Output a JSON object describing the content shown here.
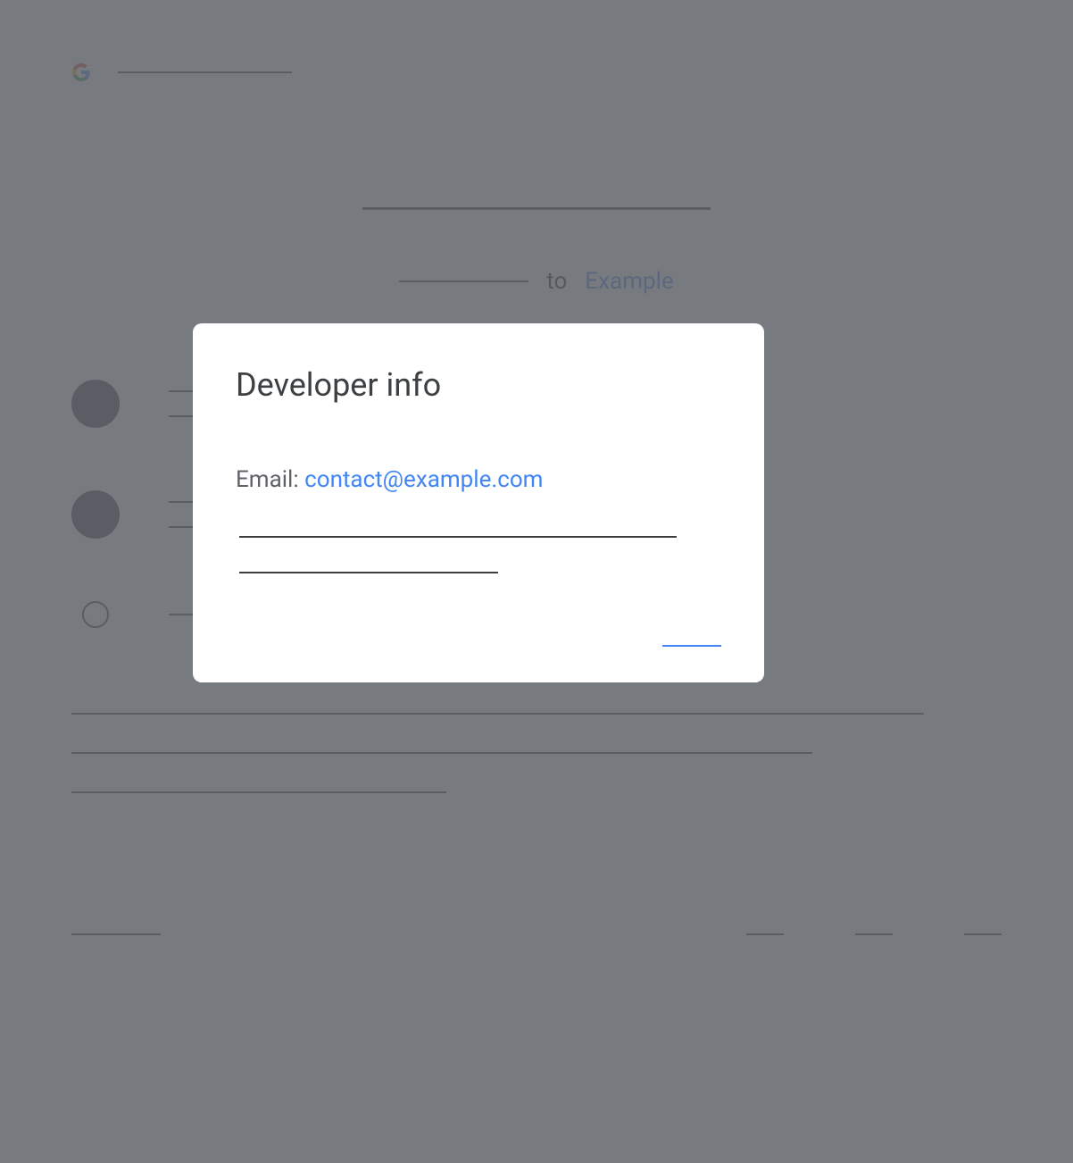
{
  "background": {
    "subtitle_to": "to",
    "subtitle_app": "Example"
  },
  "modal": {
    "title": "Developer info",
    "email_label": "Email: ",
    "email_value": "contact@example.com"
  }
}
